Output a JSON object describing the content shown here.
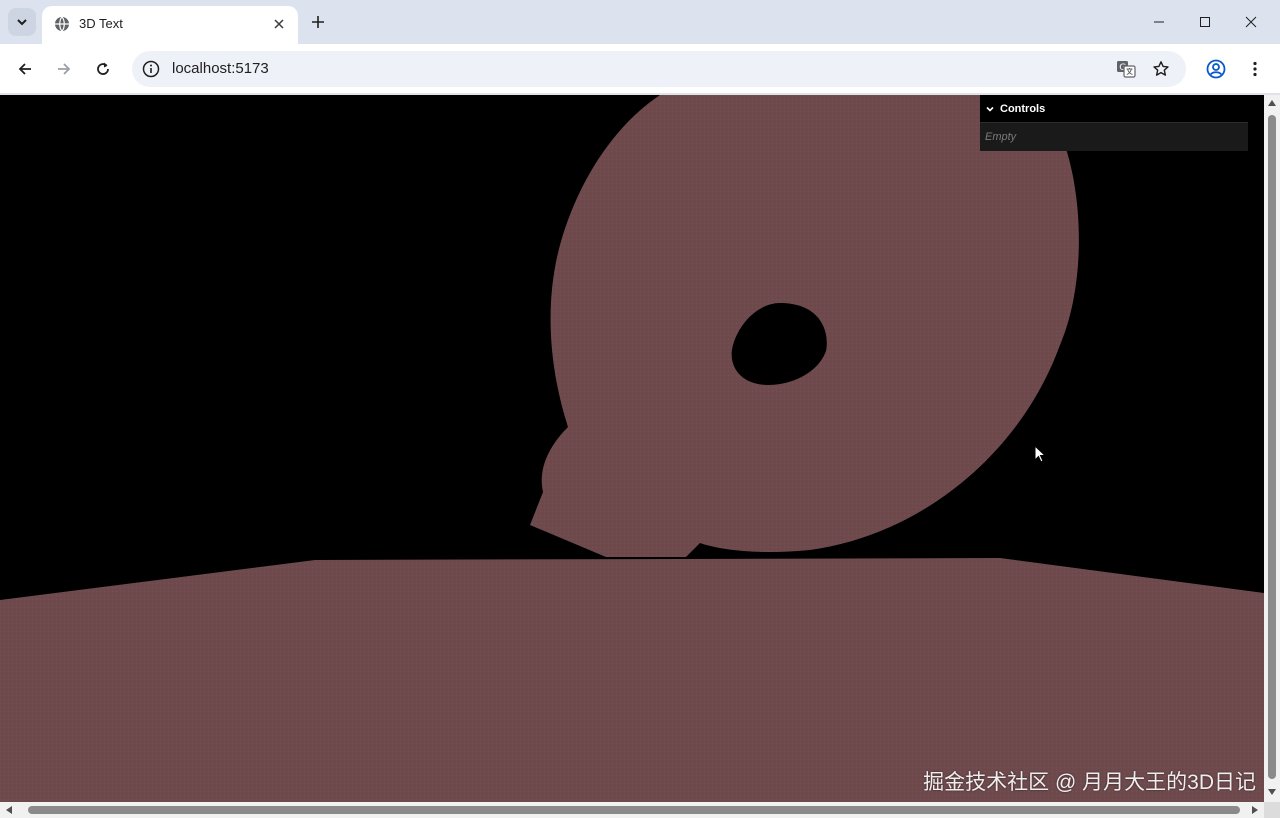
{
  "browser": {
    "tab_title": "3D Text",
    "url": "localhost:5173"
  },
  "controls_panel": {
    "title": "Controls",
    "empty_text": "Empty"
  },
  "watermark": "掘金技术社区 @ 月月大王的3D日记",
  "colors": {
    "scene_background": "#000000",
    "mesh_color": "#6e4a4d",
    "tabbar": "#dde3ee",
    "toolbar": "#ffffff"
  },
  "icons": [
    "tab-search-icon",
    "globe-icon",
    "close-icon",
    "plus-icon",
    "minimize-icon",
    "maximize-icon",
    "window-close-icon",
    "back-icon",
    "forward-icon",
    "reload-icon",
    "info-icon",
    "translate-icon",
    "star-icon",
    "profile-icon",
    "menu-icon",
    "chevron-down-icon"
  ]
}
